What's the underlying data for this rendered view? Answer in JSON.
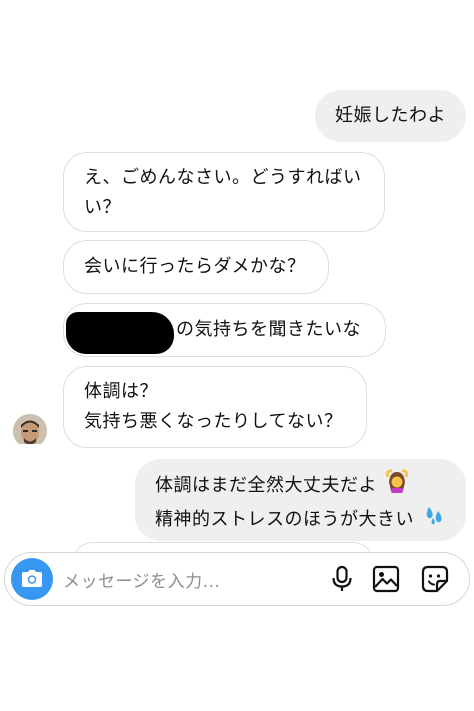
{
  "messages": [
    {
      "direction": "outgoing",
      "lines": [
        "妊娠したわよ"
      ]
    },
    {
      "direction": "incoming",
      "lines": [
        "え、ごめんなさい。どうすればい",
        "い？"
      ]
    },
    {
      "direction": "incoming",
      "lines": [
        "会いに行ったらダメかな？"
      ]
    },
    {
      "direction": "incoming",
      "lines": [
        "の気持ちを聞きたいな"
      ],
      "redacted_prefix": true
    },
    {
      "direction": "incoming",
      "lines": [
        "体調は？",
        "気持ち悪くなったりしてない？"
      ]
    },
    {
      "direction": "outgoing",
      "lines": [
        "体調はまだ全然大丈夫だよ",
        "精神的ストレスのほうが大きい"
      ],
      "emojis": [
        "woman-gesturing-ok-icon",
        "sweat-droplets-icon"
      ]
    }
  ],
  "composer": {
    "placeholder": "メッセージを入力..."
  },
  "colors": {
    "accent": "#3897f0",
    "outgoing_bubble": "#efefef",
    "incoming_border": "#dedede"
  }
}
